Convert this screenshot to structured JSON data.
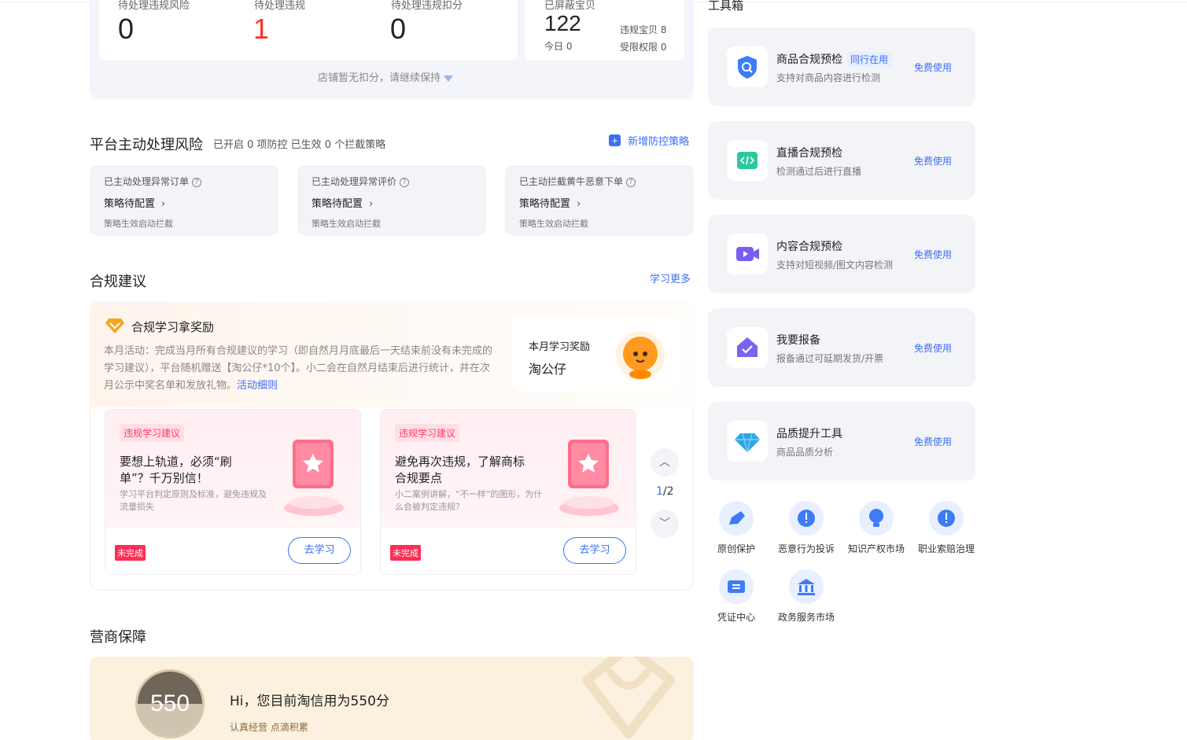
{
  "stats": {
    "items": [
      {
        "label": "待处理违规风险",
        "value": "0"
      },
      {
        "label": "待处理违规",
        "value": "1"
      },
      {
        "label": "待处理违规扣分",
        "value": "0"
      }
    ],
    "total_label": "已屏蔽宝贝",
    "total": "122",
    "today_label": "今日",
    "today_value": "0",
    "violation_label": "违规宝贝",
    "violation_value": "8",
    "restrict_label": "受限权限",
    "restrict_value": "0",
    "deduct_note": "店铺暂无扣分，请继续保持"
  },
  "risk": {
    "title": "平台主动处理风险",
    "summary": "已开启 0 项防控 已生效 0 个拦截策略",
    "add_link": "新增防控策略",
    "cards": [
      {
        "title": "已主动处理异常订单",
        "status": "策略待配置",
        "note": "策略生效启动拦截"
      },
      {
        "title": "已主动处理异常评价",
        "status": "策略待配置",
        "note": "策略生效启动拦截"
      },
      {
        "title": "已主动拦截黄牛恶意下单",
        "status": "策略待配置",
        "note": "策略生效启动拦截"
      }
    ]
  },
  "compliance": {
    "title": "合规建议",
    "more": "学习更多",
    "reward_title": "合规学习拿奖励",
    "desc": "本月活动：完成当月所有合规建议的学习（即自然月月底最后一天结束前没有未完成的学习建议），平台随机赠送【淘公仔*10个】。小二会在自然月结束后进行统计，并在次月公示中奖名单和发放礼物。",
    "rule_link": "活动细则",
    "month_reward_label": "本月学习奖励",
    "month_reward_value": "淘公仔",
    "cards": [
      {
        "tag": "违规学习建议",
        "title": "要想上轨道，必须“刷单”？千万别信！",
        "desc": "学习平台判定原则及标准，避免违规及流量损失",
        "status": "未完成",
        "button": "去学习"
      },
      {
        "tag": "违规学习建议",
        "title": "避免再次违规，了解商标合规要点",
        "desc": "小二案例讲解，“不一样”的图形，为什么会被判定违规？",
        "status": "未完成",
        "button": "去学习"
      }
    ],
    "pager_current": "1",
    "pager_total": "/2"
  },
  "business": {
    "title": "营商保障",
    "score": "550",
    "greeting": "Hi，您目前淘信用为550分",
    "slogan": "认真经营 点滴积累"
  },
  "toolbox": {
    "title": "工具箱",
    "tools": [
      {
        "name": "商品合规预检",
        "tag": "同行在用",
        "desc": "支持对商品内容进行检测",
        "action": "免费使用",
        "icon": "shield-search-icon",
        "color": "#3d7cf5"
      },
      {
        "name": "直播合规预检",
        "tag": "",
        "desc": "检测通过后进行直播",
        "action": "免费使用",
        "icon": "code-icon",
        "color": "#2cc9a0"
      },
      {
        "name": "内容合规预检",
        "tag": "",
        "desc": "支持对短视频/图文内容检测",
        "action": "免费使用",
        "icon": "video-camera-icon",
        "color": "#7a5cf0"
      },
      {
        "name": "我要报备",
        "tag": "",
        "desc": "报备通过可延期发货/开票",
        "action": "免费使用",
        "icon": "house-check-icon",
        "color": "#7b63f0"
      },
      {
        "name": "品质提升工具",
        "tag": "",
        "desc": "商品品质分析",
        "action": "免费使用",
        "icon": "diamond-icon",
        "color": "#2aa6e8"
      }
    ],
    "shortcuts": [
      {
        "label": "原创保护",
        "icon": "pen-icon"
      },
      {
        "label": "恶意行为投诉",
        "icon": "alert-icon"
      },
      {
        "label": "知识产权市场",
        "icon": "bulb-icon"
      },
      {
        "label": "职业索赔治理",
        "icon": "alert-icon"
      },
      {
        "label": "凭证中心",
        "icon": "ticket-icon"
      },
      {
        "label": "政务服务市场",
        "icon": "bank-icon"
      }
    ]
  }
}
